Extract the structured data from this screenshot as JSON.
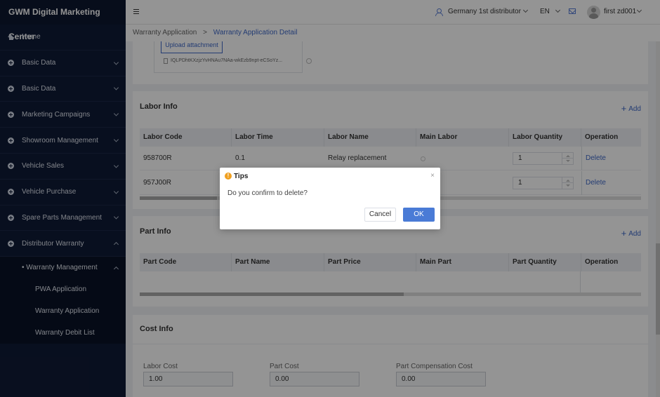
{
  "app": {
    "title": "GWM Digital Marketing Center"
  },
  "sidebar": {
    "items": [
      {
        "label": "Home"
      },
      {
        "label": "Basic Data"
      },
      {
        "label": "Basic Data"
      },
      {
        "label": "Marketing Campaigns"
      },
      {
        "label": "Showroom Management"
      },
      {
        "label": "Vehicle Sales"
      },
      {
        "label": "Vehicle Purchase"
      },
      {
        "label": "Spare Parts Management"
      },
      {
        "label": "Distributor Warranty"
      }
    ],
    "submenu": {
      "parent": "• Warranty Management",
      "items": [
        {
          "label": "PWA Application"
        },
        {
          "label": "Warranty Application"
        },
        {
          "label": "Warranty Debit List"
        }
      ]
    }
  },
  "header": {
    "distributor": "Germany 1st distributor",
    "language": "EN",
    "username": "first zd001"
  },
  "breadcrumb": {
    "parent": "Warranty Application",
    "separator": ">",
    "current": "Warranty Application Detail"
  },
  "upload": {
    "button_label": "Upload attachment",
    "file_name": "IQLPDhtKXzjzYvHNAu7NAa-wkEzb9npt-eCSoYz..."
  },
  "labor_info": {
    "title": "Labor Info",
    "add_label": "Add",
    "columns": [
      "Labor Code",
      "Labor Time",
      "Labor Name",
      "Main Labor",
      "Labor Quantity",
      "Operation"
    ],
    "rows": [
      {
        "code": "958700R",
        "time": "0.1",
        "name": "Relay replacement",
        "quantity": "1",
        "operation": "Delete"
      },
      {
        "code": "957J00R",
        "time": "",
        "name": "",
        "quantity": "1",
        "operation": "Delete"
      }
    ]
  },
  "part_info": {
    "title": "Part Info",
    "add_label": "Add",
    "columns": [
      "Part Code",
      "Part Name",
      "Part Price",
      "Main Part",
      "Part Quantity",
      "Operation"
    ]
  },
  "cost_info": {
    "title": "Cost Info",
    "fields": [
      {
        "label": "Labor Cost",
        "value": "1.00"
      },
      {
        "label": "Part Cost",
        "value": "0.00"
      },
      {
        "label": "Part Compensation Cost",
        "value": "0.00"
      }
    ]
  },
  "dialog": {
    "title": "Tips",
    "message": "Do you confirm to delete?",
    "cancel_label": "Cancel",
    "ok_label": "OK",
    "close_glyph": "×",
    "warn_glyph": "!"
  },
  "colors": {
    "sidebar_bg": "#0f1a36",
    "accent": "#3e68c7",
    "ok_button": "#4a7bd6",
    "warning": "#f0a020"
  }
}
